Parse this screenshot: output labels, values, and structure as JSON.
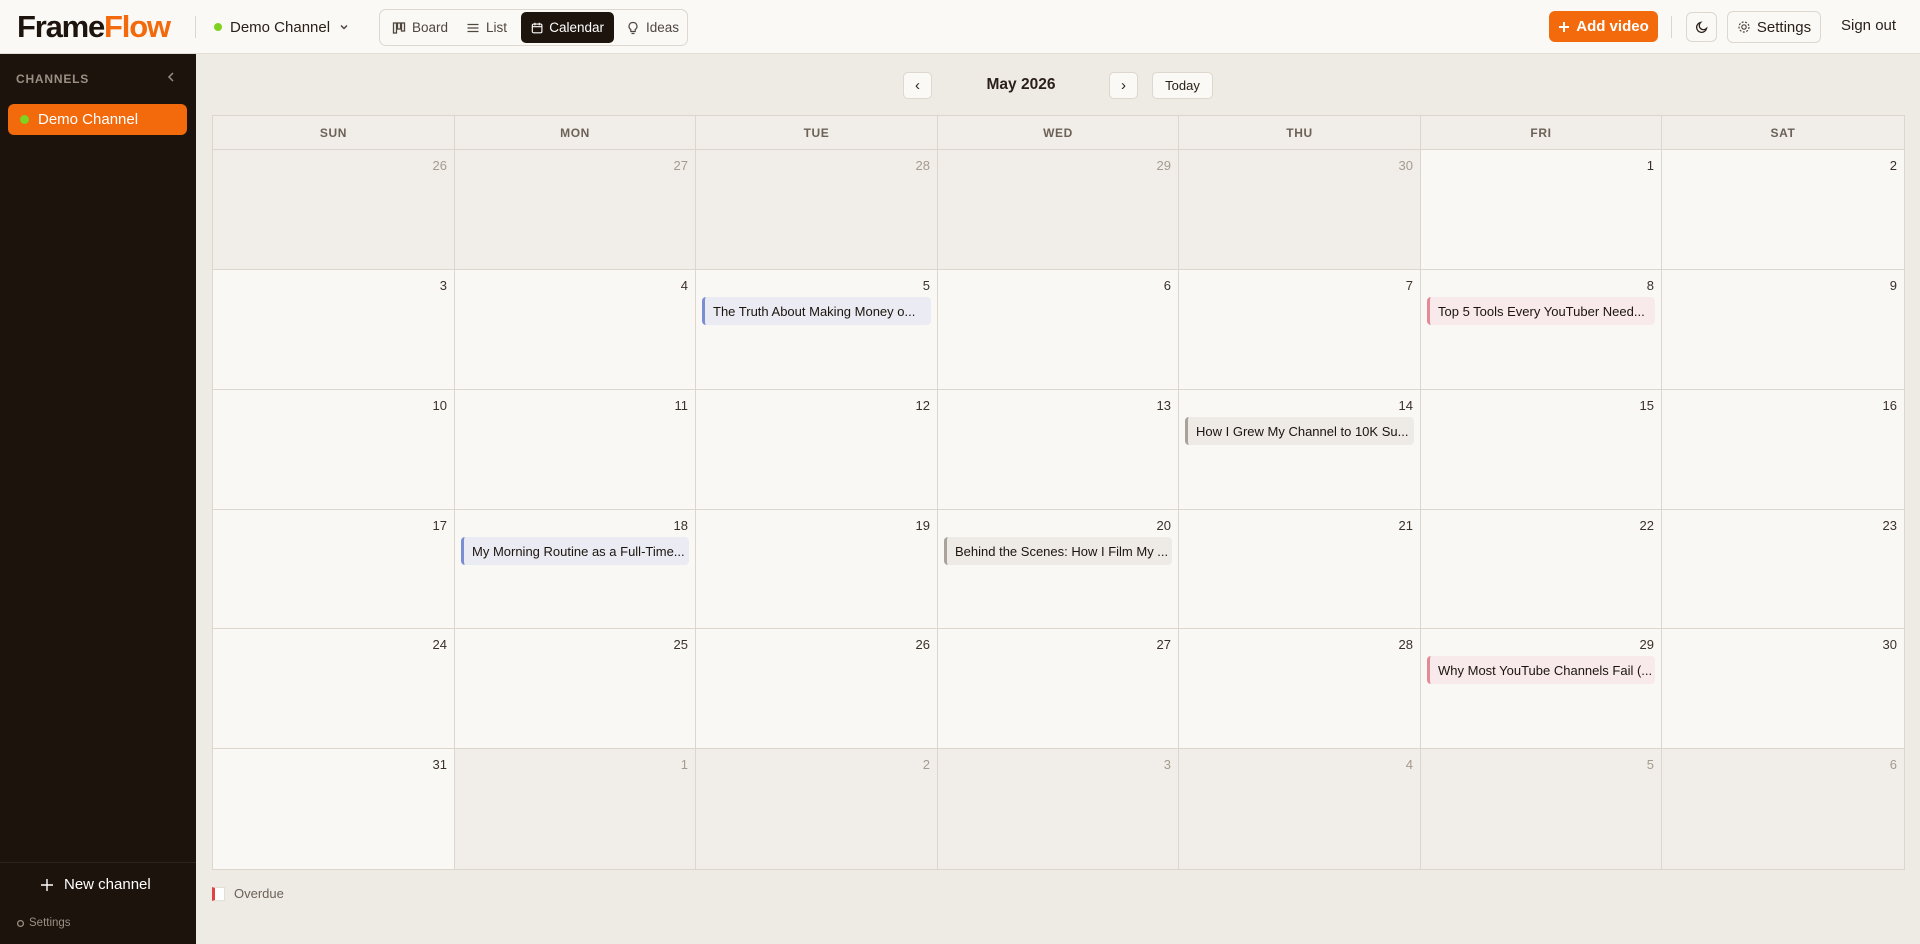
{
  "header": {
    "logo_part1": "Frame",
    "logo_part2": "Flow",
    "channel_name": "Demo Channel",
    "tabs": [
      {
        "label": "Board",
        "icon": "board-icon"
      },
      {
        "label": "List",
        "icon": "list-icon"
      },
      {
        "label": "Calendar",
        "icon": "calendar-icon",
        "active": true
      },
      {
        "label": "Ideas",
        "icon": "lightbulb-icon"
      }
    ],
    "add_video": "Add video",
    "settings": "Settings",
    "sign_out": "Sign out"
  },
  "sidebar": {
    "title": "CHANNELS",
    "channels": [
      {
        "name": "Demo Channel",
        "status_color": "#7ed321"
      }
    ],
    "new_channel": "New channel",
    "settings": "Settings"
  },
  "calendar": {
    "month": "May 2026",
    "prev": "‹",
    "next": "›",
    "today": "Today",
    "days_of_week": [
      "SUN",
      "MON",
      "TUE",
      "WED",
      "THU",
      "FRI",
      "SAT"
    ],
    "weeks": [
      [
        {
          "d": "26",
          "out": true
        },
        {
          "d": "27",
          "out": true
        },
        {
          "d": "28",
          "out": true
        },
        {
          "d": "29",
          "out": true
        },
        {
          "d": "30",
          "out": true
        },
        {
          "d": "1"
        },
        {
          "d": "2"
        }
      ],
      [
        {
          "d": "3"
        },
        {
          "d": "4"
        },
        {
          "d": "5",
          "event": {
            "title": "The Truth About Making Money o...",
            "color": "blue"
          }
        },
        {
          "d": "6"
        },
        {
          "d": "7"
        },
        {
          "d": "8",
          "event": {
            "title": "Top 5 Tools Every YouTuber Need...",
            "color": "pink"
          }
        },
        {
          "d": "9"
        }
      ],
      [
        {
          "d": "10"
        },
        {
          "d": "11"
        },
        {
          "d": "12"
        },
        {
          "d": "13"
        },
        {
          "d": "14",
          "event": {
            "title": "How I Grew My Channel to 10K Su...",
            "color": "gray"
          }
        },
        {
          "d": "15"
        },
        {
          "d": "16"
        }
      ],
      [
        {
          "d": "17"
        },
        {
          "d": "18",
          "event": {
            "title": "My Morning Routine as a Full-Time...",
            "color": "blue"
          }
        },
        {
          "d": "19"
        },
        {
          "d": "20",
          "event": {
            "title": "Behind the Scenes: How I Film My ...",
            "color": "gray"
          }
        },
        {
          "d": "21"
        },
        {
          "d": "22"
        },
        {
          "d": "23"
        }
      ],
      [
        {
          "d": "24"
        },
        {
          "d": "25"
        },
        {
          "d": "26"
        },
        {
          "d": "27"
        },
        {
          "d": "28"
        },
        {
          "d": "29",
          "event": {
            "title": "Why Most YouTube Channels Fail (...",
            "color": "pink"
          }
        },
        {
          "d": "30"
        }
      ],
      [
        {
          "d": "31"
        },
        {
          "d": "1",
          "out": true
        },
        {
          "d": "2",
          "out": true
        },
        {
          "d": "3",
          "out": true
        },
        {
          "d": "4",
          "out": true
        },
        {
          "d": "5",
          "out": true
        },
        {
          "d": "6",
          "out": true
        }
      ]
    ]
  },
  "legend": {
    "label": "Overdue",
    "color": "#e04545"
  },
  "colors": {
    "accent": "#f26a0c",
    "sidebar_bg": "#1c130c",
    "event_blue": "#7a8fd3",
    "event_pink": "#e48a96",
    "event_gray": "#a9a39c"
  }
}
